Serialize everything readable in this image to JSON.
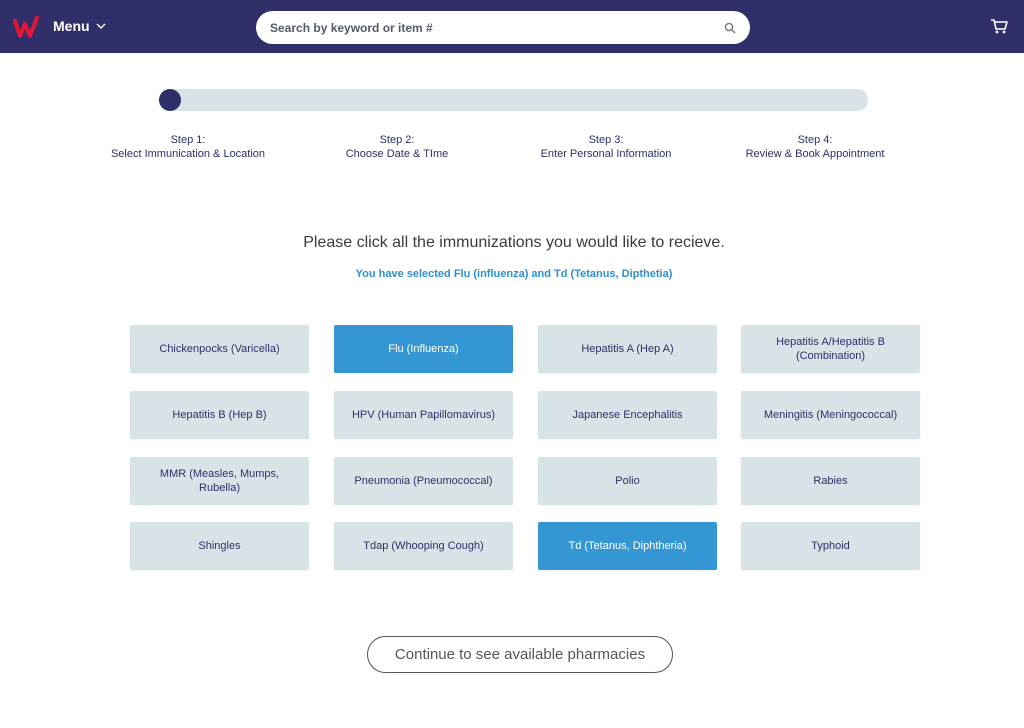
{
  "header": {
    "menu_label": "Menu",
    "search_placeholder": "Search by keyword or item #"
  },
  "progress": {
    "current_step": 1,
    "total_steps": 4
  },
  "steps": [
    {
      "title": "Step 1:",
      "label": "Select Immunication & Location"
    },
    {
      "title": "Step 2:",
      "label": "Choose Date & TIme"
    },
    {
      "title": "Step 3:",
      "label": "Enter Personal Information"
    },
    {
      "title": "Step 4:",
      "label": "Review & Book Appointment"
    }
  ],
  "main": {
    "headline": "Please click all the immunizations you would like to recieve.",
    "selected_message": "You have selected Flu (influenza) and Td (Tetanus, Dipthetia)"
  },
  "immunizations": [
    {
      "label": "Chickenpocks (Varicella)",
      "selected": false
    },
    {
      "label": "Flu (Influenza)",
      "selected": true
    },
    {
      "label": "Hepatitis A (Hep A)",
      "selected": false
    },
    {
      "label": "Hepatitis A/Hepatitis B (Combination)",
      "selected": false
    },
    {
      "label": "Hepatitis B (Hep B)",
      "selected": false
    },
    {
      "label": "HPV (Human Papillomavirus)",
      "selected": false
    },
    {
      "label": "Japanese Encephalitis",
      "selected": false
    },
    {
      "label": "Meningitis (Meningococcal)",
      "selected": false
    },
    {
      "label": "MMR (Measles, Mumps, Rubella)",
      "selected": false
    },
    {
      "label": "Pneumonia (Pneumococcal)",
      "selected": false
    },
    {
      "label": "Polio",
      "selected": false
    },
    {
      "label": "Rabies",
      "selected": false
    },
    {
      "label": "Shingles",
      "selected": false
    },
    {
      "label": "Tdap (Whooping Cough)",
      "selected": false
    },
    {
      "label": "Td (Tetanus, Diphtheria)",
      "selected": true
    },
    {
      "label": "Typhoid",
      "selected": false
    }
  ],
  "continue_label": "Continue to see available pharmacies",
  "colors": {
    "header_bg": "#302f69",
    "selected_tile": "#3497d3",
    "tile": "#d8e3e8",
    "brand_red": "#e31837"
  },
  "icons": {
    "logo": "walgreens-logo",
    "menu": "chevron-down-icon",
    "search": "search-icon",
    "cart": "cart-icon"
  }
}
